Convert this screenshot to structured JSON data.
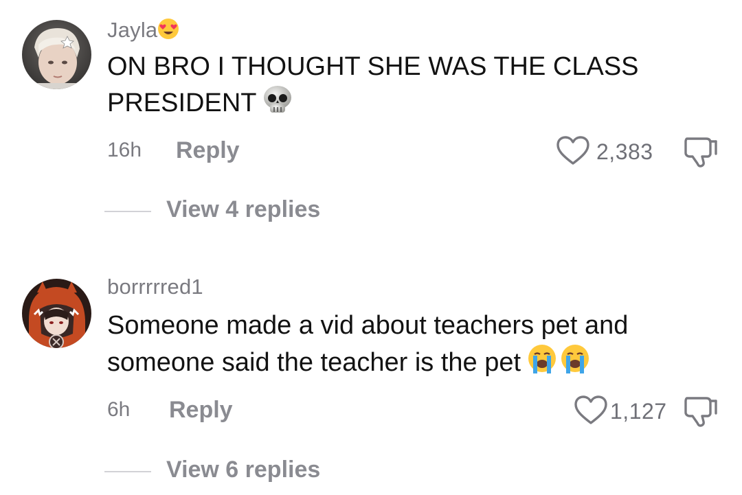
{
  "comments": [
    {
      "username": "Jayla",
      "username_emoji": "heart-eyes-emoji",
      "text_line1": "ON BRO I THOUGHT SHE WAS THE CLASS",
      "text_line2": "PRESIDENT",
      "text_emoji": "skull-emoji",
      "time": "16h",
      "reply_label": "Reply",
      "likes": "2,383",
      "view_replies": "View 4 replies"
    },
    {
      "username": "borrrrred1",
      "text_line1": "Someone made a vid about teachers pet and",
      "text_line2": "someone said the teacher is the pet",
      "text_emoji": "loudly-crying-emoji",
      "time": "6h",
      "reply_label": "Reply",
      "likes": "1,127",
      "view_replies": "View 6 replies"
    }
  ],
  "colors": {
    "text": "#121212",
    "muted": "#7a7a80",
    "reply": "#8a8b91"
  }
}
